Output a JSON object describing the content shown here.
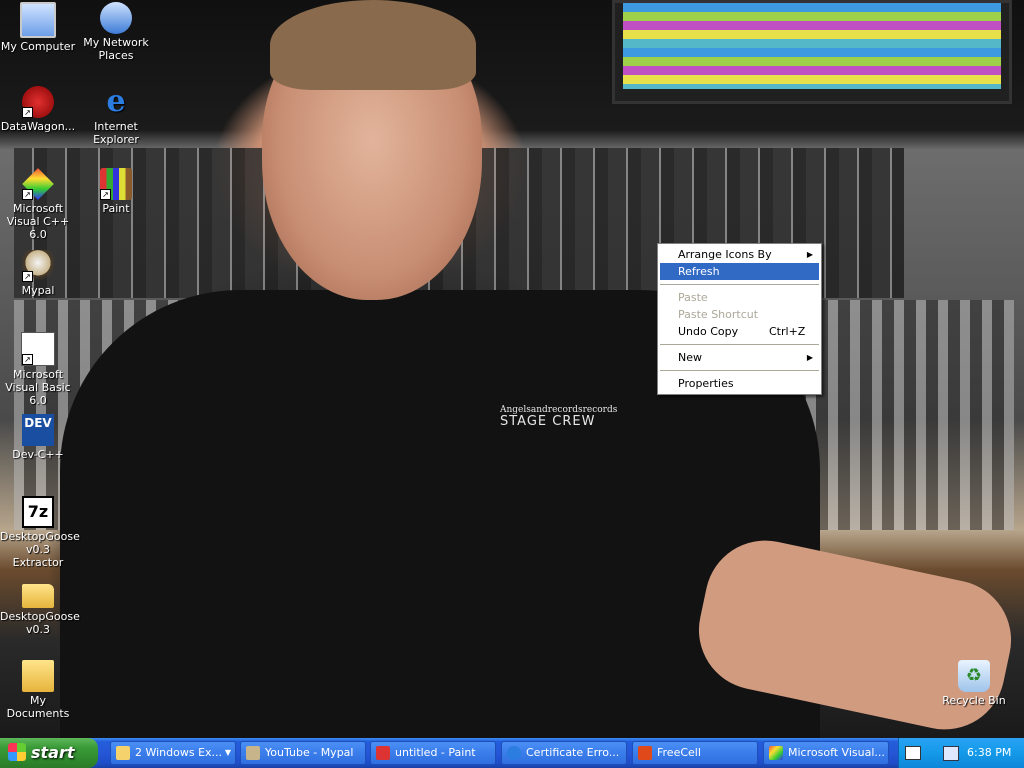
{
  "desktop": {
    "icons": [
      {
        "label": "My Computer",
        "icon": "my-computer-icon"
      },
      {
        "label": "My Network Places",
        "icon": "network-places-icon"
      },
      {
        "label": "DataWagon...",
        "icon": "datawagon-icon"
      },
      {
        "label": "Internet Explorer",
        "icon": "internet-explorer-icon"
      },
      {
        "label": "Microsoft Visual C++ 6.0",
        "icon": "visual-cpp-icon"
      },
      {
        "label": "Paint",
        "icon": "paint-icon"
      },
      {
        "label": "Mypal",
        "icon": "mypal-icon"
      },
      {
        "label": "Microsoft Visual Basic 6.0",
        "icon": "visual-basic-icon"
      },
      {
        "label": "Dev-C++",
        "icon": "dev-cpp-icon"
      },
      {
        "label": "DesktopGoose v0.3 Extractor",
        "icon": "7zip-icon"
      },
      {
        "label": "DesktopGoose v0.3",
        "icon": "folder-icon"
      },
      {
        "label": "My Documents",
        "icon": "my-documents-icon"
      },
      {
        "label": "Recycle Bin",
        "icon": "recycle-bin-icon"
      }
    ],
    "icon_texts": {
      "dev": "DEV",
      "sevenzip": "7z",
      "ie": "e"
    },
    "wallpaper_text": {
      "line1": "Angelsandrecordsrecords",
      "line2": "STAGE CREW"
    }
  },
  "context_menu": {
    "items": [
      {
        "label": "Arrange Icons By",
        "submenu": true,
        "state": "normal"
      },
      {
        "label": "Refresh",
        "state": "highlighted"
      },
      {
        "label": "Paste",
        "state": "disabled"
      },
      {
        "label": "Paste Shortcut",
        "state": "disabled"
      },
      {
        "label": "Undo Copy",
        "shortcut": "Ctrl+Z",
        "state": "normal"
      },
      {
        "label": "New",
        "submenu": true,
        "state": "normal"
      },
      {
        "label": "Properties",
        "state": "normal"
      }
    ],
    "submenu_glyph": "▶"
  },
  "taskbar": {
    "start_label": "start",
    "buttons": [
      {
        "label": "2 Windows Ex...",
        "icon": "folder-icon",
        "color": "#f5d26b",
        "dropdown": "▼"
      },
      {
        "label": "YouTube - Mypal",
        "icon": "mypal-icon",
        "color": "#c8b48a"
      },
      {
        "label": "untitled - Paint",
        "icon": "paint-icon",
        "color": "#d33"
      },
      {
        "label": "Certificate Erro...",
        "icon": "internet-explorer-icon",
        "color": "#2b7de0"
      },
      {
        "label": "FreeCell",
        "icon": "freecell-icon",
        "color": "#e04a1a"
      },
      {
        "label": "Microsoft Visual...",
        "icon": "visual-cpp-icon",
        "color": "#e53"
      }
    ],
    "clock": "6:38 PM"
  },
  "colors": {
    "taskbar_blue": "#245edb",
    "start_green": "#3c9c39",
    "menu_highlight": "#316ac5",
    "menu_disabled": "#aca899"
  }
}
